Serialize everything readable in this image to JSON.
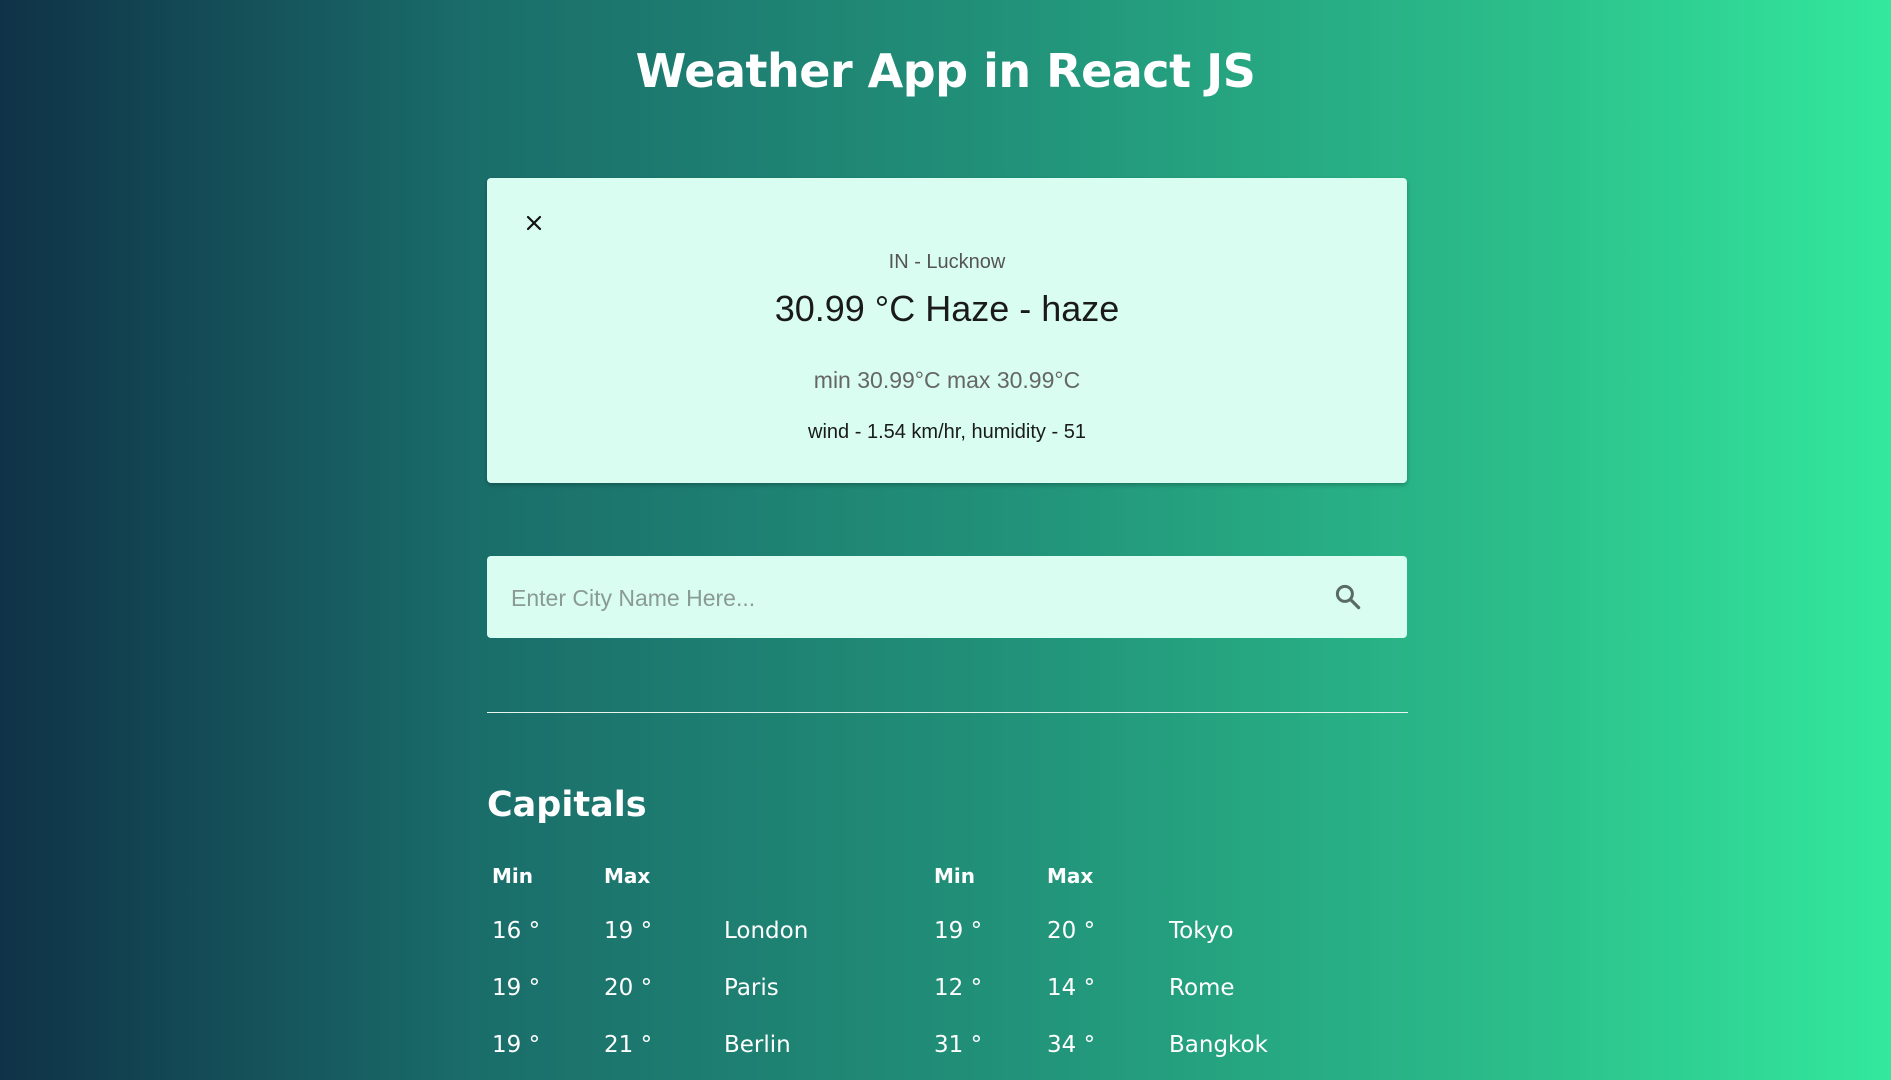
{
  "app": {
    "title": "Weather App in React JS"
  },
  "weather_card": {
    "location": "IN - Lucknow",
    "temperature_description": "30.99 °C Haze - haze",
    "min_max": "min 30.99°C max 30.99°C",
    "wind_humidity": "wind - 1.54 km/hr, humidity - 51",
    "close_icon": "close-icon"
  },
  "search": {
    "placeholder": "Enter City Name Here...",
    "value": "",
    "icon": "search-icon"
  },
  "capitals": {
    "title": "Capitals",
    "headers": {
      "min": "Min",
      "max": "Max"
    },
    "left": [
      {
        "min": "16 °",
        "max": "19 °",
        "city": "London"
      },
      {
        "min": "19 °",
        "max": "20 °",
        "city": "Paris"
      },
      {
        "min": "19 °",
        "max": "21 °",
        "city": "Berlin"
      }
    ],
    "right": [
      {
        "min": "19 °",
        "max": "20 °",
        "city": "Tokyo"
      },
      {
        "min": "12 °",
        "max": "14 °",
        "city": "Rome"
      },
      {
        "min": "31 °",
        "max": "34 °",
        "city": "Bangkok"
      }
    ]
  },
  "colors": {
    "background_left": "#0f3247",
    "background_right": "#33e89d",
    "card_background": "#d9fdf0",
    "text_primary": "#ffffff"
  }
}
